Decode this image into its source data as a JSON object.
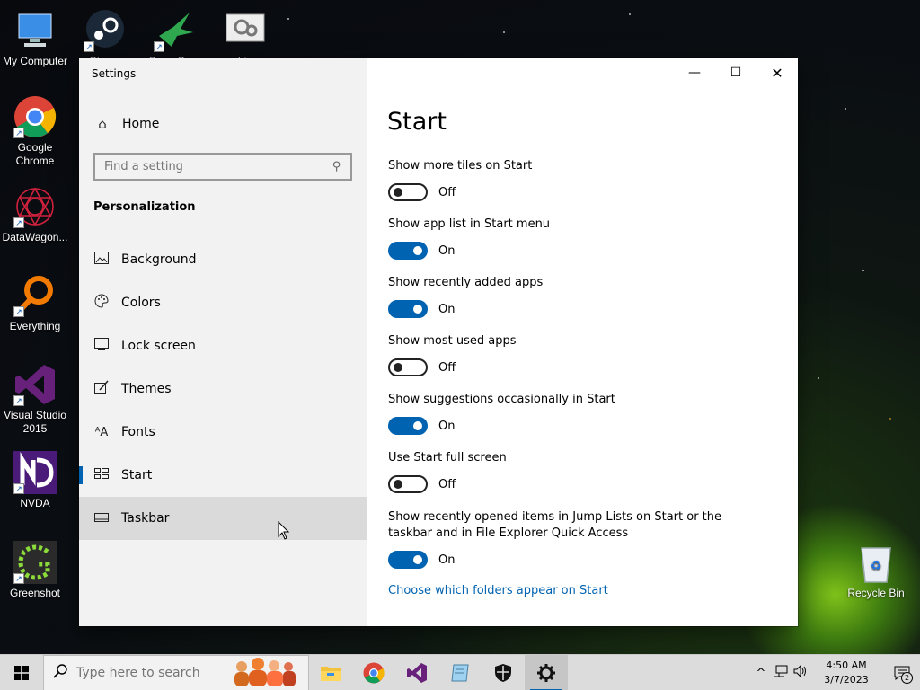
{
  "desktop": {
    "icons": [
      {
        "label": "My Computer"
      },
      {
        "label": "Steam"
      },
      {
        "label": "SuperSync"
      },
      {
        "label": "bin"
      },
      {
        "label": "Google Chrome"
      },
      {
        "label": "DataWagon..."
      },
      {
        "label": "Everything"
      },
      {
        "label": "Visual Studio 2015"
      },
      {
        "label": "NVDA"
      },
      {
        "label": "Greenshot"
      },
      {
        "label": "Recycle Bin"
      }
    ]
  },
  "window": {
    "title": "Settings",
    "controls": {
      "minimize": "—",
      "maximize": "☐",
      "close": "✕"
    }
  },
  "sidebar": {
    "home": "Home",
    "search_placeholder": "Find a setting",
    "section": "Personalization",
    "items": [
      {
        "label": "Background",
        "icon": "image-icon"
      },
      {
        "label": "Colors",
        "icon": "palette-icon"
      },
      {
        "label": "Lock screen",
        "icon": "lock-screen-icon"
      },
      {
        "label": "Themes",
        "icon": "themes-icon"
      },
      {
        "label": "Fonts",
        "icon": "fonts-icon"
      },
      {
        "label": "Start",
        "icon": "start-icon"
      },
      {
        "label": "Taskbar",
        "icon": "taskbar-icon"
      }
    ],
    "selected": "Start",
    "hovered": "Taskbar"
  },
  "content": {
    "title": "Start",
    "settings": [
      {
        "label": "Show more tiles on Start",
        "state": "Off"
      },
      {
        "label": "Show app list in Start menu",
        "state": "On"
      },
      {
        "label": "Show recently added apps",
        "state": "On"
      },
      {
        "label": "Show most used apps",
        "state": "Off"
      },
      {
        "label": "Show suggestions occasionally in Start",
        "state": "On"
      },
      {
        "label": "Use Start full screen",
        "state": "Off"
      },
      {
        "label": "Show recently opened items in Jump Lists on Start or the taskbar and in File Explorer Quick Access",
        "state": "On"
      }
    ],
    "link": "Choose which folders appear on Start"
  },
  "taskbar": {
    "search_placeholder": "Type here to search",
    "time": "4:50 AM",
    "date": "3/7/2023",
    "notification_count": "2"
  },
  "colors": {
    "accent": "#0063b1",
    "sidebar_bg": "#f2f2f2",
    "taskbar_bg": "#dcdcdc"
  }
}
